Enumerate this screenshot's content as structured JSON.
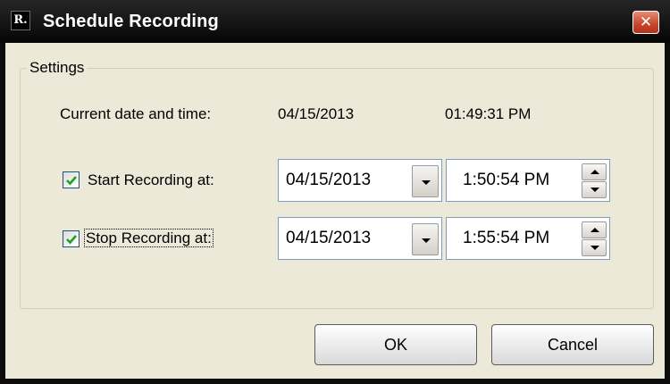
{
  "window": {
    "title": "Schedule Recording",
    "app_icon_text": "R.",
    "close_symbol": "✕"
  },
  "settings": {
    "group_label": "Settings",
    "current": {
      "label": "Current date and time:",
      "date": "04/15/2013",
      "time": "01:49:31 PM"
    },
    "start": {
      "label": "Start Recording at:",
      "checked": true,
      "date": "04/15/2013",
      "time": "1:50:54 PM"
    },
    "stop": {
      "label": "Stop Recording at:",
      "checked": true,
      "focused": true,
      "date": "04/15/2013",
      "time": "1:55:54 PM"
    }
  },
  "buttons": {
    "ok_label": "OK",
    "cancel_label": "Cancel"
  },
  "icons": {
    "app": "app-logo-icon",
    "close": "close-icon",
    "dropdown": "chevron-down-icon",
    "spin_up": "spin-up-icon",
    "spin_down": "spin-down-icon",
    "check": "checkmark-icon"
  },
  "colors": {
    "title_bar": "#060606",
    "dialog_face": "#ece9d8",
    "close_button": "#c7452a",
    "checkbox_border": "#1c5180",
    "check_mark": "#21a121"
  }
}
